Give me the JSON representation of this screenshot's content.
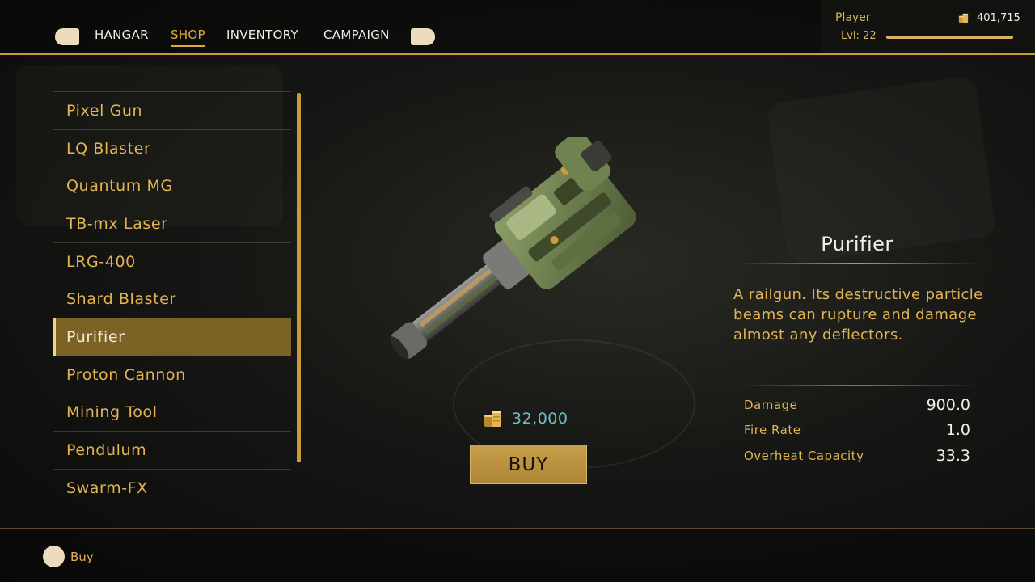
{
  "nav": {
    "tabs": [
      {
        "label": "HANGAR",
        "active": false
      },
      {
        "label": "SHOP",
        "active": true
      },
      {
        "label": "INVENTORY",
        "active": false
      },
      {
        "label": "CAMPAIGN",
        "active": false
      }
    ]
  },
  "player": {
    "name": "Player",
    "level": "Lvl: 22",
    "credits": "401,715",
    "xp_fraction": 1.0
  },
  "weapons": [
    {
      "label": "Pixel Gun"
    },
    {
      "label": "LQ Blaster"
    },
    {
      "label": "Quantum MG"
    },
    {
      "label": "TB-mx Laser"
    },
    {
      "label": "LRG-400"
    },
    {
      "label": "Shard Blaster"
    },
    {
      "label": "Purifier",
      "selected": true
    },
    {
      "label": "Proton Cannon"
    },
    {
      "label": "Mining Tool"
    },
    {
      "label": "Pendulum"
    },
    {
      "label": "Swarm-FX"
    }
  ],
  "selected": {
    "title": "Purifier",
    "description": "A railgun. Its destructive particle beams can rupture and damage almost any deflectors.",
    "price": "32,000",
    "buy_label": "BUY",
    "stats": [
      {
        "label": "Damage",
        "value": "900.0"
      },
      {
        "label": "Fire Rate",
        "value": "1.0"
      },
      {
        "label": "Overheat Capacity",
        "value": "33.3"
      }
    ]
  },
  "footer": {
    "hint_label": "Buy"
  },
  "colors": {
    "accent": "#c89a3a",
    "text_gold": "#e2b453",
    "price": "#6cc0c4",
    "selected_bg": "#7a6324"
  },
  "icons": {
    "currency": "coin-stack-icon",
    "shoulder_left": "left-bumper-icon",
    "shoulder_right": "right-bumper-icon",
    "confirm": "controller-button-icon"
  }
}
